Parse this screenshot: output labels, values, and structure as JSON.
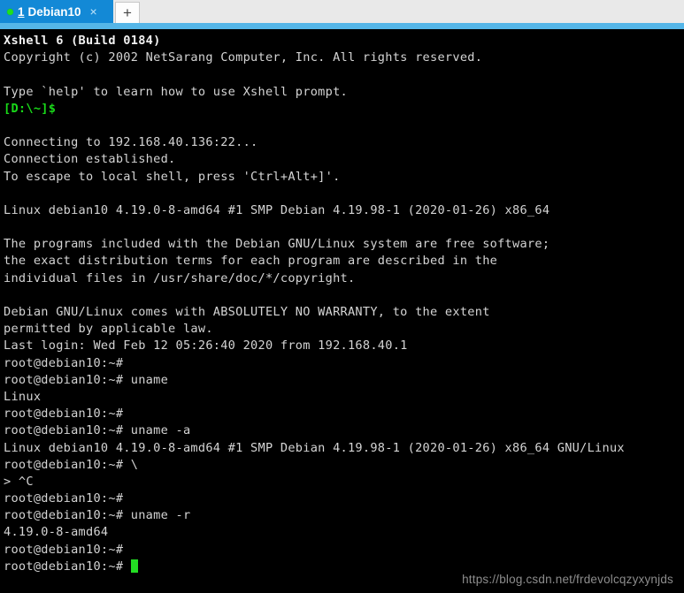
{
  "window": {
    "app_name": "Xshell 6"
  },
  "tabbar": {
    "active_tab": {
      "status_dot": "connected-green",
      "index": "1",
      "title": "Debian10",
      "close_label": "×"
    },
    "new_tab_label": "+"
  },
  "terminal": {
    "lines": [
      {
        "text": "Xshell 6 (Build 0184)",
        "style": "white"
      },
      {
        "text": "Copyright (c) 2002 NetSarang Computer, Inc. All rights reserved.",
        "style": "gray"
      },
      {
        "text": "",
        "style": "blank"
      },
      {
        "text": "Type `help' to learn how to use Xshell prompt.",
        "style": "gray"
      },
      {
        "text": "[D:\\~]$",
        "style": "green"
      },
      {
        "text": "",
        "style": "blank"
      },
      {
        "text": "Connecting to 192.168.40.136:22...",
        "style": "gray"
      },
      {
        "text": "Connection established.",
        "style": "gray"
      },
      {
        "text": "To escape to local shell, press 'Ctrl+Alt+]'.",
        "style": "gray"
      },
      {
        "text": "",
        "style": "blank"
      },
      {
        "text": "Linux debian10 4.19.0-8-amd64 #1 SMP Debian 4.19.98-1 (2020-01-26) x86_64",
        "style": "gray"
      },
      {
        "text": "",
        "style": "blank"
      },
      {
        "text": "The programs included with the Debian GNU/Linux system are free software;",
        "style": "gray"
      },
      {
        "text": "the exact distribution terms for each program are described in the",
        "style": "gray"
      },
      {
        "text": "individual files in /usr/share/doc/*/copyright.",
        "style": "gray"
      },
      {
        "text": "",
        "style": "blank"
      },
      {
        "text": "Debian GNU/Linux comes with ABSOLUTELY NO WARRANTY, to the extent",
        "style": "gray"
      },
      {
        "text": "permitted by applicable law.",
        "style": "gray"
      },
      {
        "text": "Last login: Wed Feb 12 05:26:40 2020 from 192.168.40.1",
        "style": "gray"
      },
      {
        "text": "root@debian10:~#",
        "style": "gray"
      },
      {
        "text": "root@debian10:~# uname",
        "style": "gray"
      },
      {
        "text": "Linux",
        "style": "gray"
      },
      {
        "text": "root@debian10:~#",
        "style": "gray"
      },
      {
        "text": "root@debian10:~# uname -a",
        "style": "gray"
      },
      {
        "text": "Linux debian10 4.19.0-8-amd64 #1 SMP Debian 4.19.98-1 (2020-01-26) x86_64 GNU/Linux",
        "style": "gray"
      },
      {
        "text": "root@debian10:~# \\",
        "style": "gray"
      },
      {
        "text": "> ^C",
        "style": "gray"
      },
      {
        "text": "root@debian10:~#",
        "style": "gray"
      },
      {
        "text": "root@debian10:~# uname -r",
        "style": "gray"
      },
      {
        "text": "4.19.0-8-amd64",
        "style": "gray"
      },
      {
        "text": "root@debian10:~#",
        "style": "gray"
      }
    ],
    "prompt_line": "root@debian10:~# ",
    "cursor": "block-cursor"
  },
  "watermark": {
    "text": "https://blog.csdn.net/frdevolcqzyxynjds"
  },
  "colors": {
    "tab_active_bg": "#1389d6",
    "tab_strip_bg": "#e9e9e9",
    "underline_band": "#55b6e8",
    "terminal_bg": "#000000",
    "terminal_fg": "#d4d4d4",
    "prompt_green": "#19d919",
    "cursor_green": "#23dd23",
    "watermark_fg": "#8d8d8d"
  }
}
